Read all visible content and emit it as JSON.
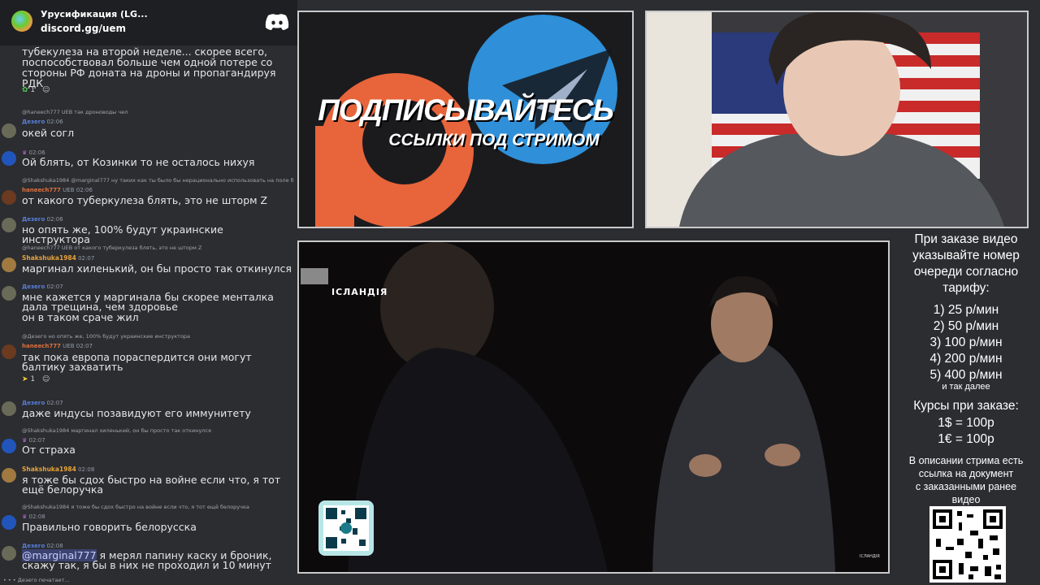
{
  "server": {
    "name": "Урусификация (LG...",
    "invite": "discord.gg/uem",
    "discord_icon": "discord-logo-icon"
  },
  "messages": [
    {
      "kind": "text",
      "top": 0,
      "lines": "тубекулеза на второй неделе... скорее всего, поспособствовал больше чем одной потере со стороны РФ доната на дроны и пропагандируя РДК"
    },
    {
      "kind": "reaction",
      "value": "1"
    },
    {
      "kind": "reply",
      "text": "@haneech777 UEB так дроноводы чел"
    },
    {
      "author": "Дезего",
      "time": "02:06",
      "text": "окей согл"
    },
    {
      "author": "",
      "time": "02:06",
      "text": "Ой блять, от Козинки то не осталось нихуя"
    },
    {
      "kind": "reply",
      "text": "@Shakshuka1984 @marginal777 ну таких как ты было бы нерационально использовать на поле б"
    },
    {
      "author": "haneech777",
      "badge": "UEB",
      "time": "02:06",
      "text": "от какого туберкулеза блять, это не шторм Z"
    },
    {
      "author": "Дезего",
      "time": "02:06",
      "text": "но опять же, 100% будут украинские инструктора"
    },
    {
      "kind": "reply",
      "text": "@haneech777 UEB от какого туберкулеза блять, это не шторм Z"
    },
    {
      "author": "Shakshuka1984",
      "time": "02:07",
      "text": "маргинал хиленький, он бы просто так откинулся"
    },
    {
      "author": "Дезего",
      "time": "02:07",
      "text": "мне кажется у маргинала бы скорее менталка дала трещина, чем здоровье",
      "text2": "он в таком сраче жил"
    },
    {
      "kind": "reply",
      "text": "@Дезего но опять же, 100% будут украинские инструктора"
    },
    {
      "author": "haneech777",
      "badge": "UEB",
      "time": "02:07",
      "text": "так пока европа пораспердится они могут балтику захватить"
    },
    {
      "kind": "reaction",
      "value": "1"
    },
    {
      "author": "Дезего",
      "time": "02:07",
      "text": "даже индусы позавидуют его иммунитету"
    },
    {
      "kind": "reply",
      "text": "@Shakshuka1984 маргинал хиленький, он бы просто так откинулся"
    },
    {
      "author": "",
      "time": "02:07",
      "text": "От страха"
    },
    {
      "author": "Shakshuka1984",
      "time": "02:08",
      "text": "я тоже бы сдох быстро на войне если что, я тот ещё белоручка"
    },
    {
      "kind": "reply",
      "text": "@Shakshuka1984 я тоже бы сдох быстро на войне если что, я тот ещё белоручка"
    },
    {
      "author": "",
      "time": "02:08",
      "text": "Правильно говорить белорусска"
    },
    {
      "author": "Дезего",
      "time": "02:08",
      "mention": "@marginal777",
      "text": " я мерял папину каску и броник, скажу так, я бы в них не проходил и 10 минут"
    }
  ],
  "typing": "Дезего печатает...",
  "promo": {
    "title": "ПОДПИСЫВАЙТЕСЬ",
    "subtitle": "ССЫЛКИ ПОД СТРИМОМ"
  },
  "video": {
    "label": "ІСЛАНДІЯ",
    "watermark": "ІСЛАНДІЯ"
  },
  "info": {
    "heading": "При заказе видео указывайте номер очереди согласно тарифу:",
    "heading_lines": [
      "При заказе видео",
      "указывайте номер",
      "очереди согласно",
      "тарифу:"
    ],
    "tariffs": [
      "1) 25 р/мин",
      "2) 50 р/мин",
      "3) 100 р/мин",
      "4) 200 р/мин",
      "5) 400 р/мин"
    ],
    "tariffs_more": "и так далее",
    "rates_heading": "Курсы при заказе:",
    "rates": [
      "1$ = 100р",
      "1€ = 100р"
    ],
    "desc_lines": [
      "В описании стрима есть",
      "ссылка на документ",
      "с заказанными ранее",
      "видео"
    ]
  },
  "colors": {
    "chat_bg": "#2b2d31",
    "header_bg": "#1e1f22",
    "mention": "#7289da",
    "author_dezero": "#5a7fdc",
    "author_haneech": "#e0703c",
    "author_shakshuka": "#e8a23a",
    "telegram": "#2f8fd8",
    "patreon": "#e8643a"
  }
}
